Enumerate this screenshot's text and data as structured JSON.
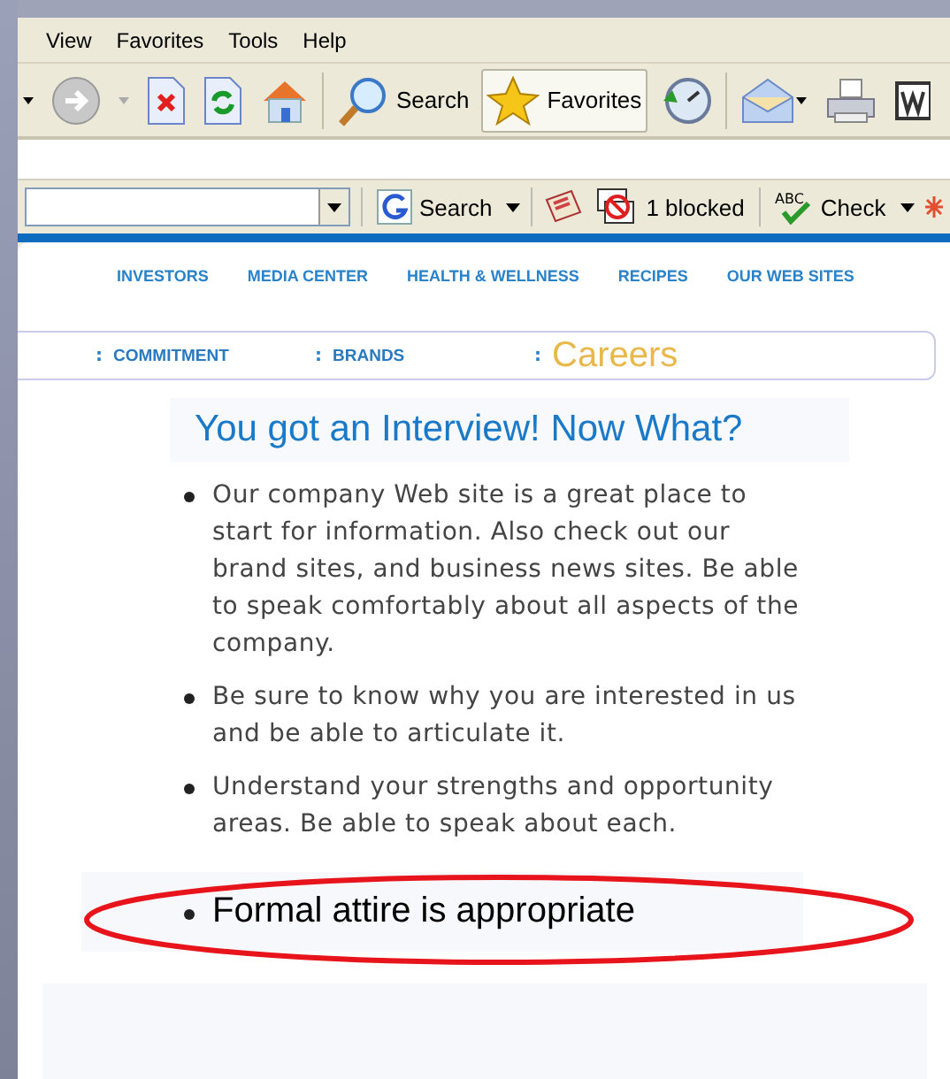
{
  "menu": [
    "View",
    "Favorites",
    "Tools",
    "Help"
  ],
  "toolbar": [
    {
      "kind": "dropdown",
      "pressed": false
    },
    {
      "kind": "forward",
      "pressed": false
    },
    {
      "kind": "dropdown-disabled",
      "pressed": false
    },
    {
      "kind": "stop",
      "pressed": false
    },
    {
      "kind": "refresh",
      "pressed": false
    },
    {
      "kind": "home",
      "pressed": false
    },
    {
      "kind": "separator"
    },
    {
      "kind": "search",
      "label": "Search",
      "pressed": false
    },
    {
      "kind": "favorites",
      "label": "Favorites",
      "pressed": true
    },
    {
      "kind": "history",
      "pressed": false
    },
    {
      "kind": "separator"
    },
    {
      "kind": "mail",
      "pressed": false
    },
    {
      "kind": "print",
      "pressed": false
    },
    {
      "kind": "word",
      "pressed": false
    }
  ],
  "google_bar": {
    "search_label": "Search",
    "blocked": "1 blocked",
    "check": "Check",
    "check_icon_text": "ABC"
  },
  "nav": [
    "INVESTORS",
    "MEDIA CENTER",
    "HEALTH & WELLNESS",
    "RECIPES",
    "OUR WEB SITES"
  ],
  "subnav": [
    {
      "label": "COMMITMENT",
      "selected": false
    },
    {
      "label": "BRANDS",
      "selected": false
    },
    {
      "label": "Careers",
      "selected": true
    }
  ],
  "subnav_sep": ":",
  "heading": "You got an Interview! Now What?",
  "bullets": [
    {
      "text": "Our company Web site is a great place to start for information. Also check out our brand sites, and business news sites. Be able to speak comfortably about all aspects of the company.",
      "circled": false
    },
    {
      "text": "Be sure to know why you are interested in us and be able to articulate it.",
      "circled": false
    },
    {
      "text": "Understand your strengths and opportunity areas. Be able to speak about each.",
      "circled": false
    },
    {
      "text": "Formal attire is appropriate",
      "circled": true
    }
  ]
}
